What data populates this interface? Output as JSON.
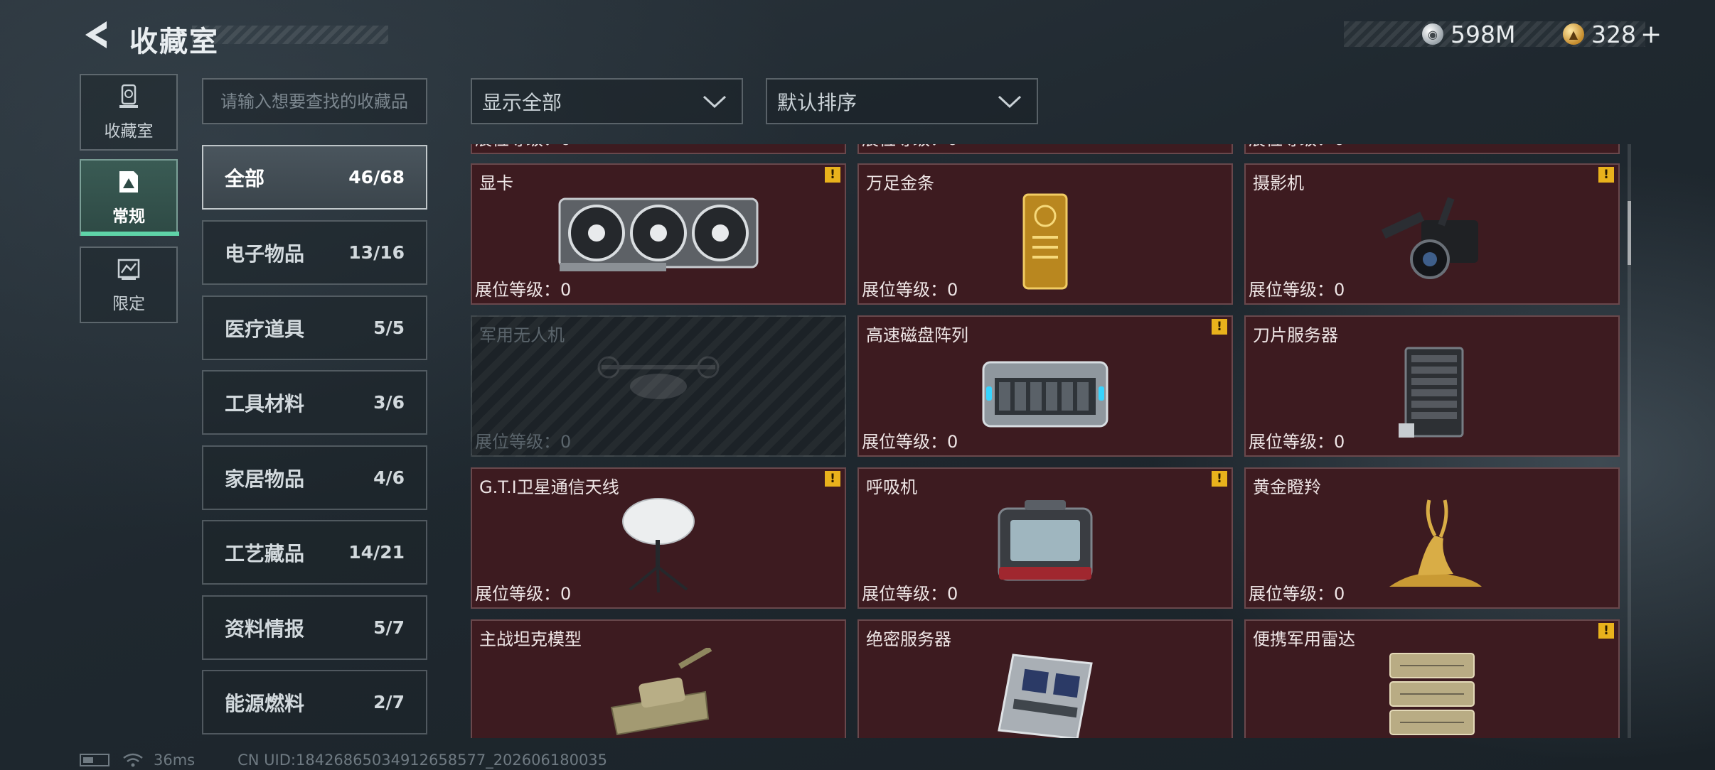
{
  "header": {
    "title": "收藏室",
    "currency": [
      {
        "icon": "silver-coin-icon",
        "value": "598M"
      },
      {
        "icon": "gold-coin-icon",
        "value": "328",
        "add": "+"
      }
    ]
  },
  "nav": [
    {
      "label": "收藏室",
      "icon": "trophy-icon",
      "active": false
    },
    {
      "label": "常规",
      "icon": "card-icon",
      "active": true
    },
    {
      "label": "限定",
      "icon": "limited-icon",
      "active": false
    }
  ],
  "search": {
    "placeholder": "请输入想要查找的收藏品"
  },
  "categories": [
    {
      "name": "全部",
      "count": "46/68",
      "active": true
    },
    {
      "name": "电子物品",
      "count": "13/16"
    },
    {
      "name": "医疗道具",
      "count": "5/5"
    },
    {
      "name": "工具材料",
      "count": "3/6"
    },
    {
      "name": "家居物品",
      "count": "4/6"
    },
    {
      "name": "工艺藏品",
      "count": "14/21"
    },
    {
      "name": "资料情报",
      "count": "5/7"
    },
    {
      "name": "能源燃料",
      "count": "2/7"
    }
  ],
  "filters": {
    "display": "显示全部",
    "sort": "默认排序"
  },
  "level_label": "展位等级：",
  "items": [
    {
      "name": "显卡",
      "level": "0",
      "warn": true,
      "icon": "graphics-card-icon"
    },
    {
      "name": "万足金条",
      "level": "0",
      "warn": false,
      "icon": "gold-bar-icon"
    },
    {
      "name": "摄影机",
      "level": "0",
      "warn": true,
      "icon": "video-camera-icon"
    },
    {
      "name": "军用无人机",
      "level": "0",
      "warn": false,
      "locked": true,
      "icon": "drone-icon"
    },
    {
      "name": "高速磁盘阵列",
      "level": "0",
      "warn": true,
      "icon": "disk-array-icon"
    },
    {
      "name": "刀片服务器",
      "level": "0",
      "warn": false,
      "icon": "blade-server-icon"
    },
    {
      "name": "G.T.I卫星通信天线",
      "level": "0",
      "warn": true,
      "icon": "satellite-dish-icon"
    },
    {
      "name": "呼吸机",
      "level": "0",
      "warn": true,
      "icon": "ventilator-icon"
    },
    {
      "name": "黄金瞪羚",
      "level": "0",
      "warn": false,
      "icon": "gold-gazelle-icon"
    },
    {
      "name": "主战坦克模型",
      "level": "",
      "warn": false,
      "icon": "tank-model-icon"
    },
    {
      "name": "绝密服务器",
      "level": "",
      "warn": false,
      "icon": "server-board-icon"
    },
    {
      "name": "便携军用雷达",
      "level": "",
      "warn": true,
      "icon": "radar-icon"
    }
  ],
  "footer": {
    "ping": "36ms",
    "uid": "CN UID:18426865034912658577_202606180035"
  },
  "colors": {
    "card_bg": "#3d1b20",
    "accent": "#5fd3a8",
    "warn": "#e9b21c"
  }
}
